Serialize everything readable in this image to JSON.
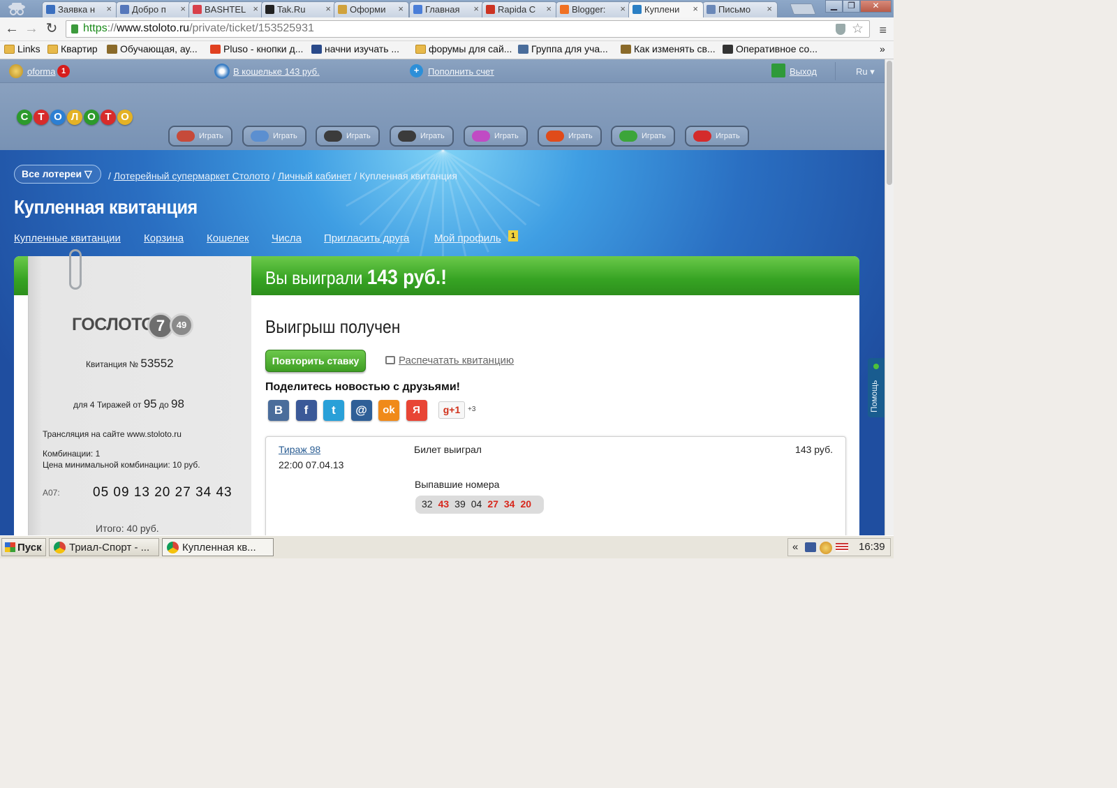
{
  "browser": {
    "tabs": [
      {
        "label": "Заявка н",
        "color": "#3b6fbf"
      },
      {
        "label": "Добро п",
        "color": "#5577bb"
      },
      {
        "label": "BASHTEL",
        "color": "#d8404a"
      },
      {
        "label": "Tak.Ru",
        "color": "#222222"
      },
      {
        "label": "Оформи",
        "color": "#d0a23c"
      },
      {
        "label": "Главная",
        "color": "#4a7ed8"
      },
      {
        "label": "Rapida C",
        "color": "#cc3322"
      },
      {
        "label": "Blogger:",
        "color": "#f07022"
      },
      {
        "label": "Куплени",
        "color": "#2b7fc4"
      },
      {
        "label": "Письмо",
        "color": "#6a88b8"
      }
    ],
    "tab_close_glyph": "×",
    "url_scheme": "https",
    "url_sep": "://",
    "url_host": "www.stoloto.ru",
    "url_path": "/private/ticket/153525931",
    "bookmarks": [
      {
        "label": "Links",
        "icon": "folder-icon"
      },
      {
        "label": "Квартир",
        "icon": "folder-icon"
      },
      {
        "label": "Обучающая, ау...",
        "icon": "bookmark-icon"
      },
      {
        "label": "Pluso - кнопки д...",
        "icon": "pluso-icon"
      },
      {
        "label": "начни изучать ...",
        "icon": "b-icon"
      },
      {
        "label": "форумы для сай...",
        "icon": "folder-icon"
      },
      {
        "label": "Группа для уча...",
        "icon": "vk-icon"
      },
      {
        "label": "Как изменять св...",
        "icon": "bookmark-icon"
      },
      {
        "label": "Оперативное со...",
        "icon": "g-icon"
      }
    ],
    "bookmarks_more": "»"
  },
  "site": {
    "user": "oforma",
    "user_badge": "1",
    "wallet": "В кошельке 143 руб.",
    "topup": "Пополнить счет",
    "logout": "Выход",
    "lang": "Ru ▾",
    "play_label": "Играть",
    "games": [
      {
        "icon": "lotto-icon",
        "color": "#c64a3a"
      },
      {
        "icon": "sportloto-icon",
        "color": "#5b8fd0"
      },
      {
        "icon": "5-36-icon",
        "color": "#3b3b3b"
      },
      {
        "icon": "6-45-icon",
        "color": "#3b3b3b"
      },
      {
        "icon": "rapido-icon",
        "color": "#c04bc4"
      },
      {
        "icon": "6-49-icon",
        "color": "#e04b1a"
      },
      {
        "icon": "keno-icon",
        "color": "#3ca53a"
      },
      {
        "icon": "top3-icon",
        "color": "#d42b2b"
      },
      {
        "icon": "sportprognoz-icon",
        "color": "#d24a2b"
      },
      {
        "icon": "zhilishnaya-icon",
        "color": "#7a4a3a"
      },
      {
        "icon": "7-49-icon",
        "color": "#3b3b3b"
      }
    ],
    "logo_letters": [
      "С",
      "Т",
      "О",
      "Л",
      "О",
      "Т",
      "О"
    ],
    "logo_colors": [
      "#2c9a2c",
      "#d72b2b",
      "#2c7fd3",
      "#e4b225",
      "#2c9a2c",
      "#d72b2b",
      "#e4b225"
    ]
  },
  "page": {
    "all_lotteries": "Все лотереи ▽",
    "breadcrumb": {
      "sep": "/",
      "home": "Лотерейный супермаркет Столото",
      "cabinet": "Личный кабинет",
      "current": "Купленная квитанция"
    },
    "title": "Купленная квитанция",
    "subnav": [
      "Купленные квитанции",
      "Корзина",
      "Кошелек",
      "Числа",
      "Пригласить друга",
      "Мой профиль"
    ],
    "profile_badge": "1",
    "win_prefix": "Вы выиграли",
    "win_amount": "143 руб.!",
    "status": "Выигрыш получен",
    "repeat_btn": "Повторить ставку",
    "print_link": "Распечатать квитанцию",
    "share_title": "Поделитесь новостью с друзьями!",
    "social": [
      {
        "icon": "vk-icon",
        "glyph": "В",
        "color": "#4a6d9b"
      },
      {
        "icon": "facebook-icon",
        "glyph": "f",
        "color": "#3b5998"
      },
      {
        "icon": "twitter-icon",
        "glyph": "t",
        "color": "#29a0d8"
      },
      {
        "icon": "mailru-icon",
        "glyph": "@",
        "color": "#2f5f97"
      },
      {
        "icon": "odnoklassniki-icon",
        "glyph": "ok",
        "color": "#f08a19"
      },
      {
        "icon": "yandex-icon",
        "glyph": "Я",
        "color": "#e84535"
      }
    ],
    "gplus": "g+1",
    "share_count": "+3",
    "help": "Помощь"
  },
  "receipt": {
    "brand": "ГОСЛОТО",
    "ball_big": "7",
    "ball_small": "49",
    "number_label": "Квитанция №",
    "number": "53552",
    "draws_prefix": "для 4 Тиражей от",
    "draw_from": "95",
    "draw_mid": "до",
    "draw_to": "98",
    "broadcast": "Трансляция на сайте www.stoloto.ru",
    "combos": "Комбинации: 1",
    "min_price": "Цена минимальной комбинации: 10 руб.",
    "line_label": "А07:",
    "numbers": "05 09 13 20 27 34 43",
    "total": "Итого: 40 руб."
  },
  "draw": {
    "name": "Тираж 98",
    "datetime": "22:00 07.04.13",
    "result": "Билет выиграл",
    "prize": "143 руб.",
    "drawn_label": "Выпавшие номера",
    "drawn": [
      {
        "n": "32",
        "hit": false
      },
      {
        "n": "43",
        "hit": true
      },
      {
        "n": "39",
        "hit": false
      },
      {
        "n": "04",
        "hit": false
      },
      {
        "n": "27",
        "hit": true
      },
      {
        "n": "34",
        "hit": true
      },
      {
        "n": "20",
        "hit": true
      }
    ]
  },
  "taskbar": {
    "start": "Пуск",
    "tasks": [
      "Триал-Спорт - ...",
      "Купленная кв..."
    ],
    "tray_arrow": "«",
    "time": "16:39"
  }
}
